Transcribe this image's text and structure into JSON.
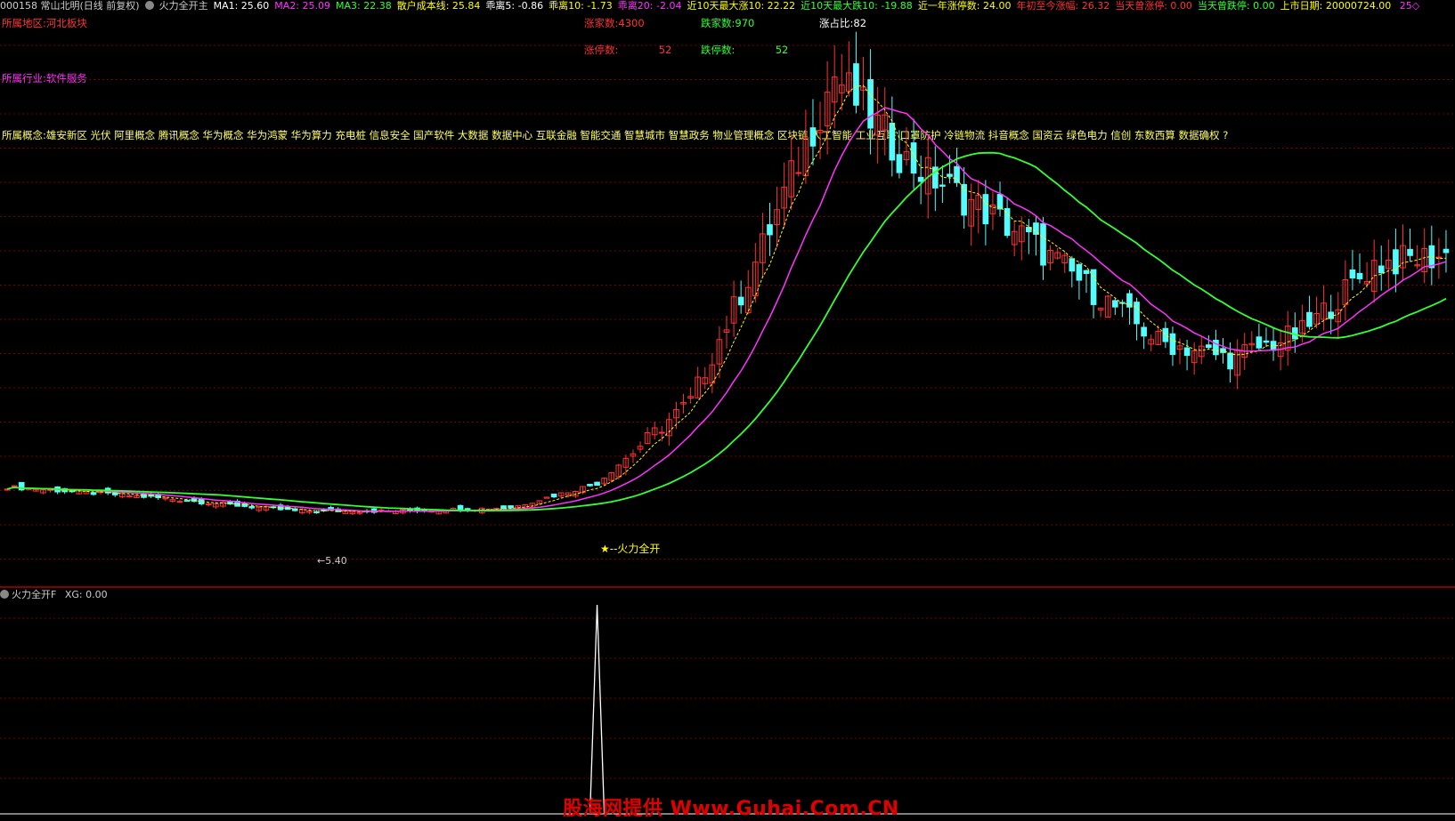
{
  "header": {
    "stock_code": "000158",
    "stock_name": "常山北明(日线 前复权)",
    "indicator_name": "火力全开主",
    "items": [
      {
        "label": "MA1:",
        "value": "25.60",
        "color": "#ffffff"
      },
      {
        "label": "MA2:",
        "value": "25.09",
        "color": "#ff33ff"
      },
      {
        "label": "MA3:",
        "value": "22.38",
        "color": "#33ff33"
      },
      {
        "label": "散户成本线:",
        "value": "25.84",
        "color": "#ffff00"
      },
      {
        "label": "乖离5:",
        "value": "-0.86",
        "color": "#ffffff"
      },
      {
        "label": "乖离10:",
        "value": "-1.73",
        "color": "#ffff00"
      },
      {
        "label": "乖离20:",
        "value": "-2.04",
        "color": "#ff33ff"
      },
      {
        "label": "近10天最大涨10:",
        "value": "22.22",
        "color": "#ffff00"
      },
      {
        "label": "近10天最大跌10:",
        "value": "-19.88",
        "color": "#33ff33"
      },
      {
        "label": "近一年涨停数:",
        "value": "24.00",
        "color": "#ffff00"
      },
      {
        "label": "年初至今涨幅:",
        "value": "26.32",
        "color": "#ff3333"
      },
      {
        "label": "当天曾涨停:",
        "value": "0.00",
        "color": "#ff3333"
      },
      {
        "label": "当天曾跌停:",
        "value": "0.00",
        "color": "#33ff33"
      },
      {
        "label": "上市日期:",
        "value": "20000724.00",
        "color": "#ffff00"
      },
      {
        "label": "",
        "value": "25◇",
        "color": "#ff33ff"
      }
    ]
  },
  "info": {
    "region": "所属地区:河北板块",
    "industry": "所属行业:软件服务",
    "concepts": "所属概念:雄安新区 光伏 阿里概念 腾讯概念 华为概念 华为鸿蒙 华为算力 充电桩 信息安全 国产软件 大数据 数据中心 互联金融 智能交通 智慧城市 智慧政务 物业管理概念 区块链 人工智能 工业互联 口罩防护 冷链物流 抖音概念 国资云 绿色电力 信创 东数西算 数据确权 ?",
    "up_count_label": "涨家数:",
    "up_count": "4300",
    "down_count_label": "跌家数:",
    "down_count": "970",
    "limit_up_label": "涨停数:",
    "limit_up": "52",
    "limit_down_label": "跌停数:",
    "limit_down": "52",
    "up_ratio": "涨占比:82"
  },
  "colors": {
    "up": "#ff3232",
    "down": "#54fcfc",
    "ma1": "#ffff00",
    "ma2": "#ff33ff",
    "ma3": "#33ff33",
    "grid": "#7a0000",
    "axis": "#b00000",
    "signal_text": "#ffff00",
    "spike": "#ffffff"
  },
  "annotations": {
    "low_label": "←5.40",
    "signal_label": "★--火力全开"
  },
  "bottom_panel": {
    "name": "火力全开F",
    "xg_label": "XG:",
    "xg_value": "0.00"
  },
  "watermark": "股海网提供 Www.Guhai.Com.CN",
  "chart_data": {
    "type": "candlestick",
    "y_range_visible": [
      3.5,
      32
    ],
    "low_marker": 5.4,
    "signal_index": 82,
    "key_points": [
      {
        "i": 0,
        "close": 7.0
      },
      {
        "i": 20,
        "close": 6.4
      },
      {
        "i": 40,
        "close": 5.6
      },
      {
        "i": 55,
        "close": 5.6
      },
      {
        "i": 70,
        "close": 5.8
      },
      {
        "i": 82,
        "close": 7.2
      },
      {
        "i": 95,
        "close": 12.0
      },
      {
        "i": 105,
        "close": 21.0
      },
      {
        "i": 115,
        "close": 31.0
      },
      {
        "i": 125,
        "close": 26.0
      },
      {
        "i": 140,
        "close": 22.0
      },
      {
        "i": 160,
        "close": 15.5
      },
      {
        "i": 170,
        "close": 14.5
      },
      {
        "i": 180,
        "close": 16.0
      },
      {
        "i": 190,
        "close": 20.0
      },
      {
        "i": 200,
        "close": 20.5
      }
    ],
    "signal_spike_index": 82
  }
}
